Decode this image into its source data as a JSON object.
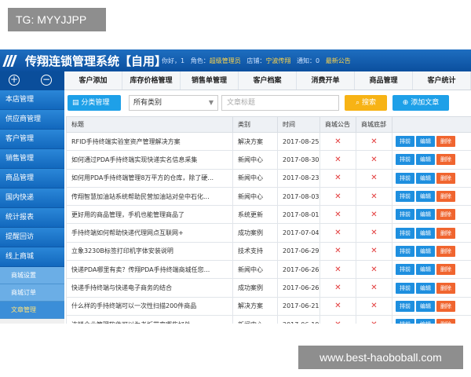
{
  "watermark": {
    "top_left": "TG: MYYJJPP",
    "bottom_right": "www.best-haoboball.com"
  },
  "header": {
    "title": "传翔连锁管理系统【自用】",
    "user_info": {
      "greeting": "你好，1",
      "role_label": "角色：",
      "role": "超级管理员",
      "store_label": "店铺：",
      "store": "宁波传翔",
      "notice_label": "通知：0",
      "latest": "最新公告"
    }
  },
  "side_toggles": {
    "expand": "⊕",
    "collapse": "⊖"
  },
  "main_nav": [
    "客户添加",
    "库存价格管理",
    "销售单管理",
    "客户档案",
    "消费开单",
    "商品管理",
    "客户统计"
  ],
  "sidebar": {
    "items": [
      "本店管理",
      "供应商管理",
      "客户管理",
      "销售管理",
      "商品管理",
      "国内快递",
      "统计报表",
      "提醒回访",
      "线上商城"
    ],
    "subitems": [
      "商城设置",
      "商城订单",
      "文章管理"
    ]
  },
  "toolbar": {
    "category_button": "分类管理",
    "category_select": "所有类别",
    "search_placeholder": "文章标题",
    "search_button": "搜索",
    "add_button": "添加文章"
  },
  "table": {
    "columns": [
      "标题",
      "类别",
      "时间",
      "商城公告",
      "商城底部",
      ""
    ],
    "actions": {
      "top": "排前",
      "edit": "编辑",
      "delete": "删除"
    },
    "mark": "✕",
    "rows": [
      {
        "title": "RFID手持终端实验室资产管理解决方案",
        "category": "解决方案",
        "date": "2017-08-25"
      },
      {
        "title": "如何通过PDA手持终端实现快递实名信息采集",
        "category": "新闻中心",
        "date": "2017-08-30"
      },
      {
        "title": "如何用PDA手持终端管理8万平方的仓库，除了硬...",
        "category": "新闻中心",
        "date": "2017-08-23"
      },
      {
        "title": "传翔智慧加油站系统帮助民营加油站对垒中石化...",
        "category": "新闻中心",
        "date": "2017-08-03"
      },
      {
        "title": "更好用的商品管理，手机也能管理商品了",
        "category": "系统更新",
        "date": "2017-08-01"
      },
      {
        "title": "手持终端如何帮助快递代理网点互联网+",
        "category": "成功案例",
        "date": "2017-07-04"
      },
      {
        "title": "立象3230B标签打印机字体安装说明",
        "category": "技术支持",
        "date": "2017-06-29"
      },
      {
        "title": "快递PDA哪里有卖？传翔PDA手持终端商城任您...",
        "category": "新闻中心",
        "date": "2017-06-26"
      },
      {
        "title": "快递手持终端与快递电子商务的结合",
        "category": "成功案例",
        "date": "2017-06-26"
      },
      {
        "title": "什么样的手持终端可以一次性扫描200件商品",
        "category": "解决方案",
        "date": "2017-06-21"
      },
      {
        "title": "连锁企业管理软件可以为老板带来哪些好处",
        "category": "新闻中心",
        "date": "2017-06-19"
      }
    ]
  }
}
